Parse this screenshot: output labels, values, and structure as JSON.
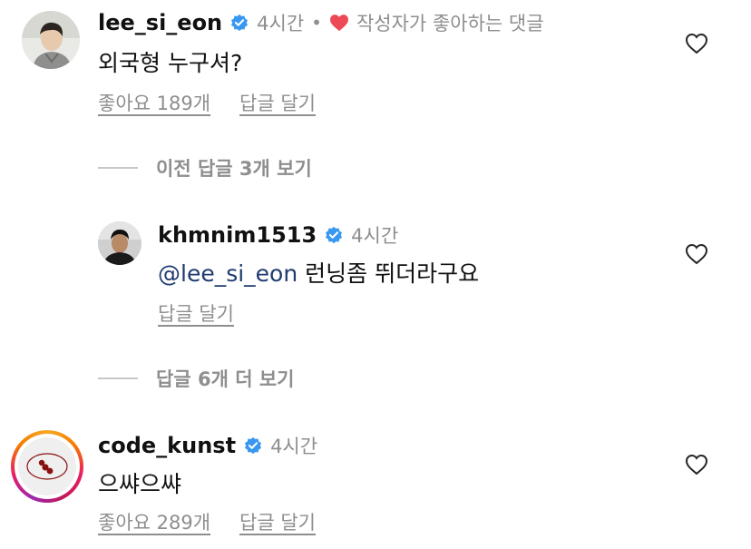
{
  "comments": [
    {
      "username": "lee_si_eon",
      "time": "4시간",
      "separator": "•",
      "liked_by_author_label": "작성자가 좋아하는 댓글",
      "text": "외국형 누구셔?",
      "likes_label": "좋아요 189개",
      "reply_label": "답글 달기"
    },
    {
      "username": "khmnim1513",
      "time": "4시간",
      "mention": "@lee_si_eon",
      "text": " 런닝좀 뛰더라구요",
      "reply_label": "답글 달기"
    },
    {
      "username": "code_kunst",
      "time": "4시간",
      "text": "으쌰으쌰",
      "likes_label": "좋아요 289개",
      "reply_label": "답글 달기"
    }
  ],
  "threads": {
    "previous_replies_label": "이전 답글 3개 보기",
    "more_replies_label": "답글 6개 더 보기"
  },
  "icons": {
    "verified": "verified-badge-icon",
    "heart_filled": "heart-filled-icon",
    "heart_outline": "heart-outline-icon"
  },
  "colors": {
    "verified_blue": "#3897f0",
    "heart_red": "#ed4956",
    "muted_text": "#8e8e8e",
    "mention_blue": "#1f3b70"
  }
}
